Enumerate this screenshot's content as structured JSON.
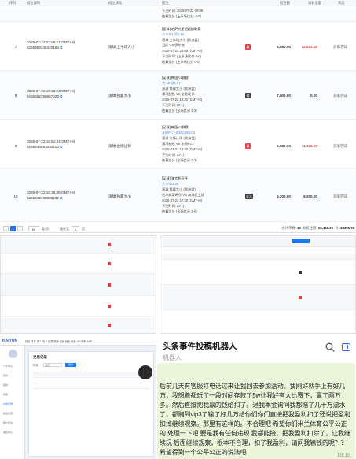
{
  "top_table": {
    "headers": [
      "序号",
      "投注详情",
      "投注球队",
      "投注",
      "投注额",
      "派彩金额",
      "状态"
    ],
    "first_row_partial": {
      "line1": "下注时间: 2025-07-22 09:09",
      "line2": "结算比分 (上半场比分: 0-0)"
    },
    "rows": [
      {
        "idx": "7",
        "time": "2025-07-22 23:06:21(GMT+8)",
        "order_id": "5255959346320164",
        "team": "滚球 上半场大小",
        "detail_lines": [
          "[足球] 哈萨克斯坦超级联赛",
          "小 0.5/1 @1.84",
          "滚球 上半场大小 (欧洲盘)",
          "卫队 VS 伊尔底",
          "2025-07-22 23:06 (GMT+8)",
          "下注时间: (上半场比分 0-0)",
          "结算比分 (上半场比分 0-0)"
        ],
        "badge": "赢",
        "stake": "6,680.00",
        "win": "12,512.00",
        "status": "派彩完毕"
      },
      {
        "idx": "8",
        "time": "2025-07-22 19:35:23(GMT+8)",
        "order_id": "5255552365867328",
        "team": "滚球 独赢大小",
        "detail_lines": [
          "[足球] 韩国K1联赛",
          "大 12 @1.97",
          "滚球 角球大小 (欧洲盘)",
          "浦项制铁 VS 全北现代",
          "2025-07-22 18:30 (GMT+8)",
          "下注时间: (0-1)",
          "结算比分 (全场比分 1-3)"
        ],
        "badge": "输",
        "stake": "7,000.00",
        "win": "0.00",
        "status": "派彩完毕"
      },
      {
        "idx": "9",
        "time": "2025-07-22 18:51:34(GMT+8)",
        "order_id": "5255544683830214",
        "team": "滚球 全场让球",
        "detail_lines": [
          "[足球] 韩国K1联赛",
          "水原FC (-0.5/1) @2.03",
          "滚球 全场让球 (欧洲盘)",
          "浦项制铁 VS 水原FC",
          "2025-07-22 18:30 (GMT+8)",
          "下注时间: (0-1)",
          "结算比分 (全场比分 1-3)"
        ],
        "badge": "赢",
        "stake": "5,580.00",
        "win": "11,166.00",
        "status": "派彩完毕"
      },
      {
        "idx": "10",
        "time": "2025-07-22 18:35:46(GMT+8)",
        "order_id": "5255416408893232",
        "team": "滚球 独赢大小",
        "detail_lines": [
          "[足球] 澳大利亚杯",
          "大 9 @2.06",
          "滚球 角球大小 (欧洲盘)",
          "达尔威奇希尔 VS 海港民工队",
          "2025-07-22 17:30 (GMT+8)",
          "下注时间: (0-1)",
          "结算比分 (全场比分 2-0)"
        ],
        "badge": "走水",
        "stake": "9,200.00",
        "win": "9,200.00",
        "status": "派彩完毕"
      }
    ]
  },
  "pager": {
    "prev": "<",
    "current": "1",
    "next": ">",
    "page_size": "50",
    "per_page_label": "条/页",
    "goto_label": "跳转至",
    "goto_value": "1",
    "page_label": "页",
    "total_count_label": "总计单数:",
    "total_count": "10",
    "total_stake_label": "总投注额:",
    "total_stake": "68,466.00",
    "total_win_label": "总:",
    "total_win": "28395.72"
  },
  "admin": {
    "logo": "KAIYUN",
    "nav": "首页 体育 真人 电子 彩票 棋牌 电竞 捕鱼 优惠 VIP 赞助 APP",
    "panel_title": "交易记录",
    "filter_label": "时间",
    "filter_value": "今日",
    "search_label": "查询",
    "menu": [
      "个人中心",
      "存款",
      "取款",
      "转账",
      "交易记录",
      "投注记录",
      "账户安全",
      "消息中心"
    ]
  },
  "chat": {
    "name": "头条事件投稿机器人",
    "subtitle": "机器人",
    "message": "后前几天有客服打电话过来让我回去参加活动。我刚好就手上有好几万，我想着都玩了一段时间存款了5w让我好有大比赛下，赢了两万多。然后直接把我赢的钱给扣了。退我本金询问我都赌了几十万流水了，都赌到vip3了输了好几万给你们你们直接把我盈利扣了还说把盈利扣掉继续观察。那里有这样的。不合理吧 希望你们米兰体育公平公正的 处理一下吧 要是我有任何违规 我都能接，把我盈利扣除了，让我继续玩 后面继续观察，根本不合理，扣了我盈利，请问我输钱的呢？？ 希望得到一个公平公正的说法吧",
    "time": "18:18"
  },
  "colors": {
    "red": "#e53e3e",
    "blue": "#1677ff",
    "bubble": "#eaf5d9"
  }
}
